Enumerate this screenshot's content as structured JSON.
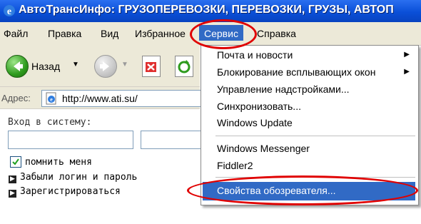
{
  "window": {
    "title": "АвтоТрансИнфо: ГРУЗОПЕРЕВОЗКИ, ПЕРЕВОЗКИ, ГРУЗЫ, АВТОП",
    "icon": "internet-explorer-icon"
  },
  "menubar": {
    "items": [
      "Файл",
      "Правка",
      "Вид",
      "Избранное",
      "Сервис",
      "Справка"
    ],
    "active": "Сервис"
  },
  "toolbar": {
    "back_label": "Назад",
    "icons": [
      "back-arrow-icon",
      "forward-arrow-icon",
      "stop-icon",
      "refresh-icon"
    ]
  },
  "addressbar": {
    "label": "Адрес:",
    "url": "http://www.ati.su/"
  },
  "page": {
    "login_label": "Вход в систему:",
    "remember_label": "помнить меня",
    "remember_checked": true,
    "links": [
      "Забыли логин и пароль",
      "Зарегистрироваться"
    ]
  },
  "dropdown": {
    "items": [
      {
        "label": "Почта и новости",
        "submenu": true
      },
      {
        "label": "Блокирование всплывающих окон",
        "submenu": true
      },
      {
        "label": "Управление надстройками...",
        "submenu": false
      },
      {
        "label": "Синхронизовать...",
        "submenu": false
      },
      {
        "label": "Windows Update",
        "submenu": false
      },
      {
        "label": "Windows Messenger",
        "submenu": false
      },
      {
        "label": "Fiddler2",
        "submenu": false
      },
      {
        "label": "Свойства обозревателя...",
        "submenu": false,
        "selected": true
      }
    ]
  },
  "annotations": {
    "color": "#e00000",
    "highlight_color": "#316ac5"
  }
}
